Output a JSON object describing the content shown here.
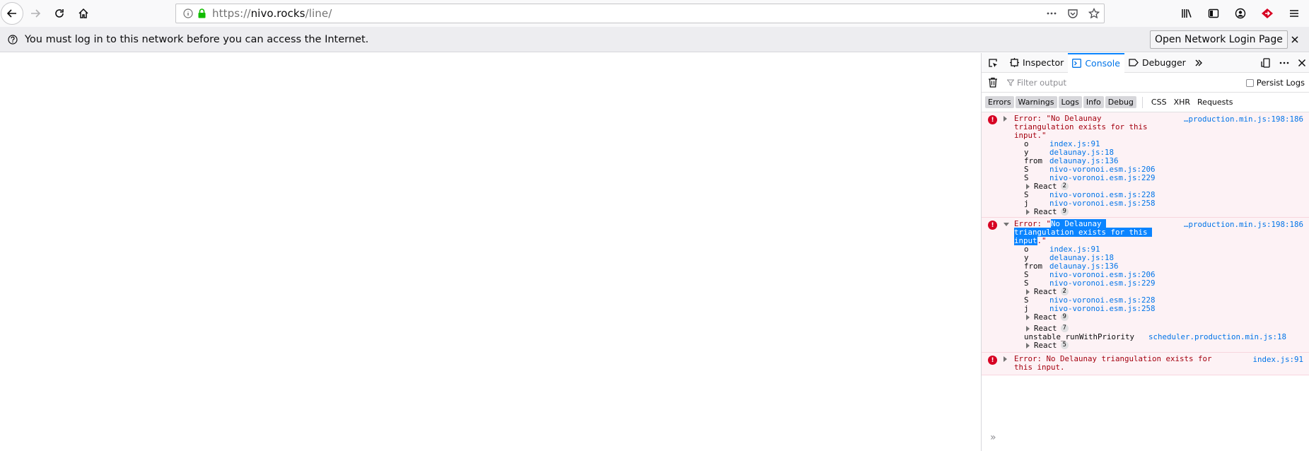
{
  "browser": {
    "url_scheme": "https://",
    "url_host": "nivo.rocks",
    "url_path": "/line/",
    "icons": [
      "back-arrow-icon",
      "forward-arrow-icon",
      "reload-icon",
      "home-icon",
      "info-icon",
      "lock-icon",
      "page-actions-icon",
      "pocket-icon",
      "bookmark-star-icon",
      "library-icon",
      "sidebar-icon",
      "account-icon",
      "extension-icon",
      "menu-icon"
    ]
  },
  "notice": {
    "text": "You must log in to this network before you can access the Internet.",
    "button": "Open Network Login Page"
  },
  "devtools": {
    "tabs": [
      {
        "label": "Inspector"
      },
      {
        "label": "Console"
      },
      {
        "label": "Debugger"
      }
    ],
    "filter_placeholder": "Filter output",
    "persist_logs": "Persist Logs",
    "categories": [
      "Errors",
      "Warnings",
      "Logs",
      "Info",
      "Debug"
    ],
    "net_categories": [
      "CSS",
      "XHR",
      "Requests"
    ],
    "messages": [
      {
        "text": "Error: \"No Delaunay triangulation exists for this input.\"",
        "source": "…production.min.js:198:186",
        "frames": [
          {
            "fn": "o",
            "loc": "index.js:91"
          },
          {
            "fn": "y",
            "loc": "delaunay.js:18"
          },
          {
            "fn": "from",
            "loc": "delaunay.js:136"
          },
          {
            "fn": "S",
            "loc": "nivo-voronoi.esm.js:206"
          },
          {
            "fn": "S",
            "loc": "nivo-voronoi.esm.js:229"
          },
          {
            "group": "React",
            "count": "2"
          },
          {
            "fn": "S",
            "loc": "nivo-voronoi.esm.js:228"
          },
          {
            "fn": "j",
            "loc": "nivo-voronoi.esm.js:258"
          },
          {
            "group": "React",
            "count": "9"
          }
        ]
      },
      {
        "text_prefix": "Error: \"",
        "text_selected": "No Delaunay triangulation exists for this input",
        "text_suffix": ".\"",
        "source": "…production.min.js:198:186",
        "frames": [
          {
            "fn": "o",
            "loc": "index.js:91"
          },
          {
            "fn": "y",
            "loc": "delaunay.js:18"
          },
          {
            "fn": "from",
            "loc": "delaunay.js:136"
          },
          {
            "fn": "S",
            "loc": "nivo-voronoi.esm.js:206"
          },
          {
            "fn": "S",
            "loc": "nivo-voronoi.esm.js:229"
          },
          {
            "group": "React",
            "count": "2"
          },
          {
            "fn": "S",
            "loc": "nivo-voronoi.esm.js:228"
          },
          {
            "fn": "j",
            "loc": "nivo-voronoi.esm.js:258"
          },
          {
            "group": "React",
            "count": "9"
          },
          {
            "group": "React",
            "count": "7"
          },
          {
            "fn": "unstable_runWithPriority",
            "loc": "scheduler.production.min.js:18"
          },
          {
            "group": "React",
            "count": "5"
          }
        ]
      },
      {
        "text": "Error: No Delaunay triangulation exists for this input.",
        "source": "index.js:91"
      }
    ],
    "prompt": "»"
  }
}
